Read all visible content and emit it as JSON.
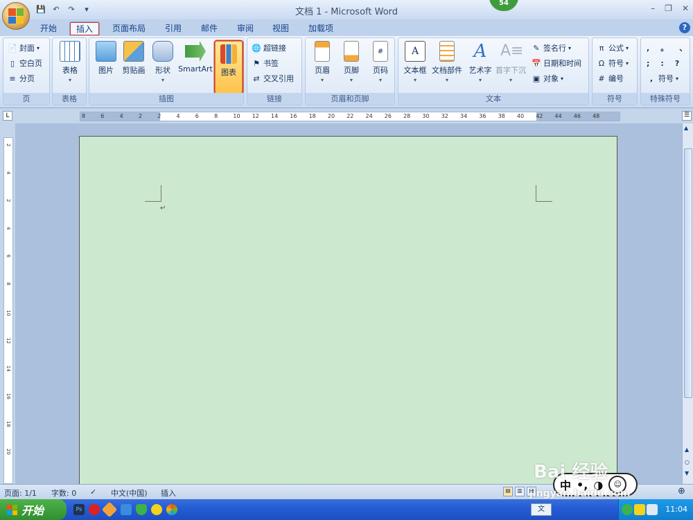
{
  "window": {
    "title": "文档 1 - Microsoft Word",
    "badge": "54",
    "help": "?"
  },
  "tabs": [
    {
      "label": "开始"
    },
    {
      "label": "插入"
    },
    {
      "label": "页面布局"
    },
    {
      "label": "引用"
    },
    {
      "label": "邮件"
    },
    {
      "label": "审阅"
    },
    {
      "label": "视图"
    },
    {
      "label": "加载项"
    }
  ],
  "ribbon": {
    "page_group": {
      "label": "页",
      "items": [
        "封面",
        "空白页",
        "分页"
      ]
    },
    "table_group": {
      "label": "表格",
      "button": "表格"
    },
    "illustrations_group": {
      "label": "插图",
      "buttons": [
        "图片",
        "剪贴画",
        "形状",
        "SmartArt",
        "图表"
      ]
    },
    "links_group": {
      "label": "链接",
      "items": [
        "超链接",
        "书签",
        "交叉引用"
      ]
    },
    "header_footer_group": {
      "label": "页眉和页脚",
      "buttons": [
        "页眉",
        "页脚",
        "页码"
      ]
    },
    "text_group": {
      "label": "文本",
      "buttons": [
        "文本框",
        "文档部件",
        "艺术字",
        "首字下沉"
      ],
      "items": [
        "签名行",
        "日期和时间",
        "对象"
      ]
    },
    "symbols_group": {
      "label": "符号",
      "items": [
        "公式",
        "符号",
        "编号"
      ]
    },
    "special_group": {
      "label": "特殊符号",
      "items": [
        ",",
        "。",
        "、",
        ";",
        ":",
        "?",
        "符号"
      ]
    }
  },
  "ruler": {
    "h_ticks": [
      "8",
      "6",
      "4",
      "2",
      "2",
      "4",
      "6",
      "8",
      "10",
      "12",
      "14",
      "16",
      "18",
      "20",
      "22",
      "24",
      "26",
      "28",
      "30",
      "32",
      "34",
      "36",
      "38",
      "40",
      "42",
      "44",
      "46",
      "48"
    ],
    "v_ticks": [
      "2",
      "4",
      "2",
      "4",
      "6",
      "8",
      "10",
      "12",
      "14",
      "16",
      "18",
      "20"
    ]
  },
  "statusbar": {
    "page": "页面: 1/1",
    "words": "字数: 0",
    "language": "中文(中国)",
    "mode": "插入"
  },
  "taskbar": {
    "start": "开始",
    "clock": "11:04",
    "ime": "中",
    "tray_text": "文"
  },
  "watermark": {
    "line1": "Bai  经验",
    "line2": "jingyan.baidu.com"
  },
  "colors": {
    "page_bg": "#cce8cf",
    "ribbon_bg": "#dce8f6",
    "taskbar": "#245dd7",
    "highlight": "#ffc34a"
  }
}
